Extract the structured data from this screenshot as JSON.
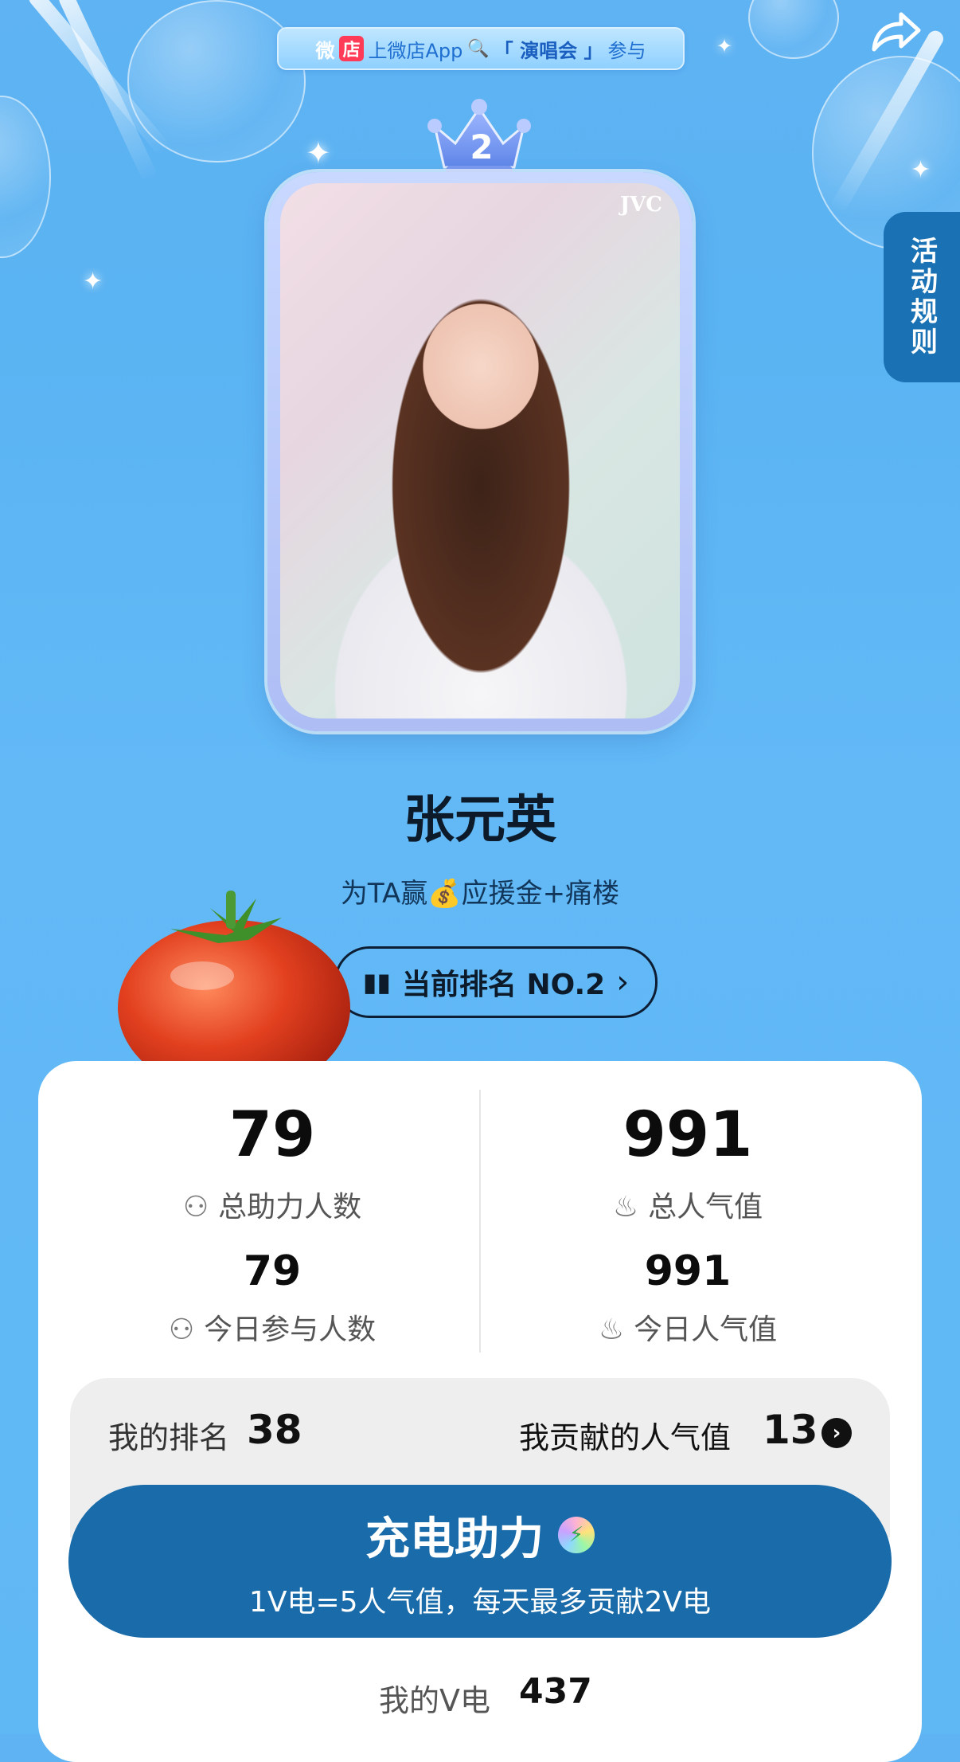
{
  "banner": {
    "wei": "微",
    "dian": "店",
    "text_prefix": "上微店App",
    "search_icon": "🔍",
    "keyword": "「 演唱会 」",
    "text_suffix": "参与"
  },
  "share_icon": "share-arrow-icon",
  "rules_tab": {
    "label": "活动规则"
  },
  "crown": {
    "rank_number": "2"
  },
  "photo": {
    "watermark": "JVC"
  },
  "artist": {
    "name": "张元英",
    "tagline_prefix": "为TA赢",
    "tagline_emoji": "💰",
    "tagline_suffix": "应援金+痛楼"
  },
  "rank_button": {
    "label": "当前排名 NO.2",
    "chevron": "›"
  },
  "stats": {
    "total_helpers_value": "79",
    "total_helpers_label": "总助力人数",
    "total_popularity_value": "991",
    "total_popularity_label": "总人气值",
    "today_participants_value": "79",
    "today_participants_label": "今日参与人数",
    "today_popularity_value": "991",
    "today_popularity_label": "今日人气值"
  },
  "mine": {
    "rank_label": "我的排名",
    "rank_value": "38",
    "contribution_label": "我贡献的人气值",
    "contribution_value": "13"
  },
  "charge_button": {
    "title": "充电助力",
    "subtitle": "1V电=5人气值，每天最多贡献2V电"
  },
  "my_v": {
    "label": "我的V电",
    "value": "437"
  },
  "colors": {
    "background": "#5fb3f3",
    "primary_button": "#196ba9",
    "rules_tab": "#1a72b4"
  }
}
